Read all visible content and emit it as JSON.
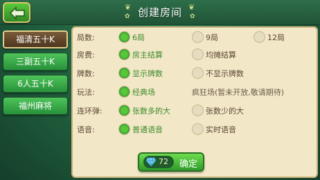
{
  "header": {
    "title": "创建房间"
  },
  "sidebar": {
    "items": [
      {
        "label": "福清五十K",
        "active": true
      },
      {
        "label": "三副五十K",
        "active": false
      },
      {
        "label": "6人五十K",
        "active": false
      },
      {
        "label": "福州麻将",
        "active": false
      }
    ]
  },
  "options": {
    "rounds": {
      "label": "局数:",
      "choices": [
        "6局",
        "9局",
        "12局"
      ],
      "selected": "6局"
    },
    "fee": {
      "label": "房费:",
      "choices": [
        "房主结算",
        "均摊结算"
      ],
      "selected": "房主结算"
    },
    "cards": {
      "label": "牌数:",
      "choices": [
        "显示牌数",
        "不显示牌数"
      ],
      "selected": "显示牌数"
    },
    "mode": {
      "label": "玩法:",
      "choices": [
        "经典场"
      ],
      "selected": "经典场",
      "note": "疯狂场(暂未开放,敬请期待)"
    },
    "bomb": {
      "label": "连环弹:",
      "choices": [
        "张数多的大",
        "张数少的大"
      ],
      "selected": "张数多的大"
    },
    "voice": {
      "label": "语音:",
      "choices": [
        "普通语音",
        "实时语音"
      ],
      "selected": "普通语音"
    }
  },
  "confirm": {
    "cost": "72",
    "label": "确定"
  },
  "colors": {
    "selected_text": "#3f8a2b",
    "panel_bg": "#f2e8c8",
    "button_green": "#2f9b2b"
  },
  "icons": [
    "back-arrow-icon",
    "diamond-icon"
  ]
}
